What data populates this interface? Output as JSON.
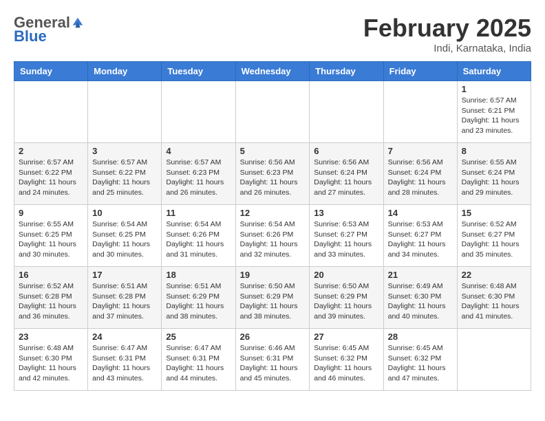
{
  "header": {
    "logo_general": "General",
    "logo_blue": "Blue",
    "month": "February 2025",
    "location": "Indi, Karnataka, India"
  },
  "weekdays": [
    "Sunday",
    "Monday",
    "Tuesday",
    "Wednesday",
    "Thursday",
    "Friday",
    "Saturday"
  ],
  "weeks": [
    [
      {
        "day": "",
        "info": ""
      },
      {
        "day": "",
        "info": ""
      },
      {
        "day": "",
        "info": ""
      },
      {
        "day": "",
        "info": ""
      },
      {
        "day": "",
        "info": ""
      },
      {
        "day": "",
        "info": ""
      },
      {
        "day": "1",
        "info": "Sunrise: 6:57 AM\nSunset: 6:21 PM\nDaylight: 11 hours\nand 23 minutes."
      }
    ],
    [
      {
        "day": "2",
        "info": "Sunrise: 6:57 AM\nSunset: 6:22 PM\nDaylight: 11 hours\nand 24 minutes."
      },
      {
        "day": "3",
        "info": "Sunrise: 6:57 AM\nSunset: 6:22 PM\nDaylight: 11 hours\nand 25 minutes."
      },
      {
        "day": "4",
        "info": "Sunrise: 6:57 AM\nSunset: 6:23 PM\nDaylight: 11 hours\nand 26 minutes."
      },
      {
        "day": "5",
        "info": "Sunrise: 6:56 AM\nSunset: 6:23 PM\nDaylight: 11 hours\nand 26 minutes."
      },
      {
        "day": "6",
        "info": "Sunrise: 6:56 AM\nSunset: 6:24 PM\nDaylight: 11 hours\nand 27 minutes."
      },
      {
        "day": "7",
        "info": "Sunrise: 6:56 AM\nSunset: 6:24 PM\nDaylight: 11 hours\nand 28 minutes."
      },
      {
        "day": "8",
        "info": "Sunrise: 6:55 AM\nSunset: 6:24 PM\nDaylight: 11 hours\nand 29 minutes."
      }
    ],
    [
      {
        "day": "9",
        "info": "Sunrise: 6:55 AM\nSunset: 6:25 PM\nDaylight: 11 hours\nand 30 minutes."
      },
      {
        "day": "10",
        "info": "Sunrise: 6:54 AM\nSunset: 6:25 PM\nDaylight: 11 hours\nand 30 minutes."
      },
      {
        "day": "11",
        "info": "Sunrise: 6:54 AM\nSunset: 6:26 PM\nDaylight: 11 hours\nand 31 minutes."
      },
      {
        "day": "12",
        "info": "Sunrise: 6:54 AM\nSunset: 6:26 PM\nDaylight: 11 hours\nand 32 minutes."
      },
      {
        "day": "13",
        "info": "Sunrise: 6:53 AM\nSunset: 6:27 PM\nDaylight: 11 hours\nand 33 minutes."
      },
      {
        "day": "14",
        "info": "Sunrise: 6:53 AM\nSunset: 6:27 PM\nDaylight: 11 hours\nand 34 minutes."
      },
      {
        "day": "15",
        "info": "Sunrise: 6:52 AM\nSunset: 6:27 PM\nDaylight: 11 hours\nand 35 minutes."
      }
    ],
    [
      {
        "day": "16",
        "info": "Sunrise: 6:52 AM\nSunset: 6:28 PM\nDaylight: 11 hours\nand 36 minutes."
      },
      {
        "day": "17",
        "info": "Sunrise: 6:51 AM\nSunset: 6:28 PM\nDaylight: 11 hours\nand 37 minutes."
      },
      {
        "day": "18",
        "info": "Sunrise: 6:51 AM\nSunset: 6:29 PM\nDaylight: 11 hours\nand 38 minutes."
      },
      {
        "day": "19",
        "info": "Sunrise: 6:50 AM\nSunset: 6:29 PM\nDaylight: 11 hours\nand 38 minutes."
      },
      {
        "day": "20",
        "info": "Sunrise: 6:50 AM\nSunset: 6:29 PM\nDaylight: 11 hours\nand 39 minutes."
      },
      {
        "day": "21",
        "info": "Sunrise: 6:49 AM\nSunset: 6:30 PM\nDaylight: 11 hours\nand 40 minutes."
      },
      {
        "day": "22",
        "info": "Sunrise: 6:48 AM\nSunset: 6:30 PM\nDaylight: 11 hours\nand 41 minutes."
      }
    ],
    [
      {
        "day": "23",
        "info": "Sunrise: 6:48 AM\nSunset: 6:30 PM\nDaylight: 11 hours\nand 42 minutes."
      },
      {
        "day": "24",
        "info": "Sunrise: 6:47 AM\nSunset: 6:31 PM\nDaylight: 11 hours\nand 43 minutes."
      },
      {
        "day": "25",
        "info": "Sunrise: 6:47 AM\nSunset: 6:31 PM\nDaylight: 11 hours\nand 44 minutes."
      },
      {
        "day": "26",
        "info": "Sunrise: 6:46 AM\nSunset: 6:31 PM\nDaylight: 11 hours\nand 45 minutes."
      },
      {
        "day": "27",
        "info": "Sunrise: 6:45 AM\nSunset: 6:32 PM\nDaylight: 11 hours\nand 46 minutes."
      },
      {
        "day": "28",
        "info": "Sunrise: 6:45 AM\nSunset: 6:32 PM\nDaylight: 11 hours\nand 47 minutes."
      },
      {
        "day": "",
        "info": ""
      }
    ]
  ]
}
